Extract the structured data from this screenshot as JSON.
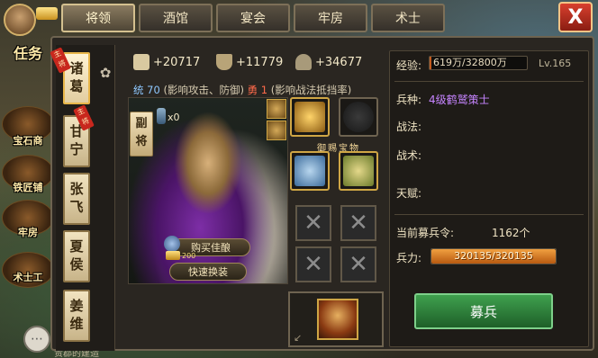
{
  "tabs": [
    {
      "label": "将领",
      "active": true
    },
    {
      "label": "酒馆",
      "active": false
    },
    {
      "label": "宴会",
      "active": false
    },
    {
      "label": "牢房",
      "active": false
    },
    {
      "label": "术士",
      "active": false
    }
  ],
  "close_label": "X",
  "left_map": {
    "top_label": "任务",
    "buildings": [
      "宝石商",
      "铁匠铺",
      "牢房",
      "术士工"
    ],
    "bottom_text": "贵郡的建造"
  },
  "heroes": [
    {
      "name": "诸葛",
      "badge": "主将",
      "selected": true
    },
    {
      "name": "甘宁",
      "badge": "主将",
      "selected": false
    },
    {
      "name": "张飞",
      "badge": "",
      "selected": false
    },
    {
      "name": "夏侯",
      "badge": "",
      "selected": false
    },
    {
      "name": "姜维",
      "badge": "",
      "selected": false
    }
  ],
  "stats": {
    "attack": "+20717",
    "defense": "+11779",
    "troops": "+34677",
    "command_label": "统",
    "command_value": "70",
    "command_desc": "(影响攻击、防御)",
    "valor_label": "勇",
    "valor_value": "1",
    "valor_desc": "(影响战法抵挡率)"
  },
  "portrait": {
    "rank": "副将",
    "token_count": "x0",
    "buy_label": "购买佳酿",
    "buy_cost": "200",
    "swap_label": "快速换装"
  },
  "treasure_label": "御赐宝物",
  "info": {
    "exp_label": "经验:",
    "exp_value": "619万/32800万",
    "exp_progress": 0.019,
    "level": "Lv.165",
    "troop_type_label": "兵种:",
    "troop_type_value": "4级鹤鹫策士",
    "tactic_label": "战法:",
    "strategy_label": "战术:",
    "talent_label": "天赋:",
    "recruit_orders_label": "当前募兵令:",
    "recruit_orders_value": "1162个",
    "soldiers_label": "兵力:",
    "soldiers_value": "320135/320135",
    "soldiers_progress": 1.0,
    "recruit_button": "募兵"
  }
}
